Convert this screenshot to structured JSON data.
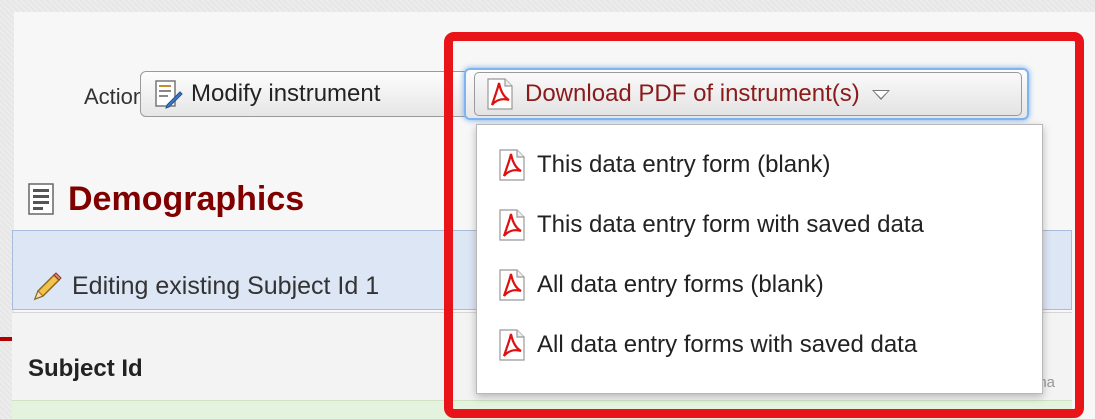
{
  "actions": {
    "label": "Actions:",
    "modify_label": "Modify instrument",
    "download_label": "Download PDF of instrument(s)"
  },
  "dropdown": {
    "items": [
      {
        "label": "This data entry form (blank)",
        "icon": "pdf-icon"
      },
      {
        "label": "This data entry form with saved data",
        "icon": "pdf-icon"
      },
      {
        "label": "All data entry forms (blank)",
        "icon": "pdf-icon"
      },
      {
        "label": "All data entry forms with saved data",
        "icon": "pdf-icon"
      }
    ]
  },
  "instrument": {
    "title": "Demographics",
    "editing_text": "Editing existing Subject Id 1",
    "subject_label": "Subject Id",
    "partial_text": "ena"
  },
  "colors": {
    "highlight": "#e8141a",
    "title": "#800000",
    "pdf_link": "#8b1a1a",
    "edit_bar": "#dde6f4"
  }
}
